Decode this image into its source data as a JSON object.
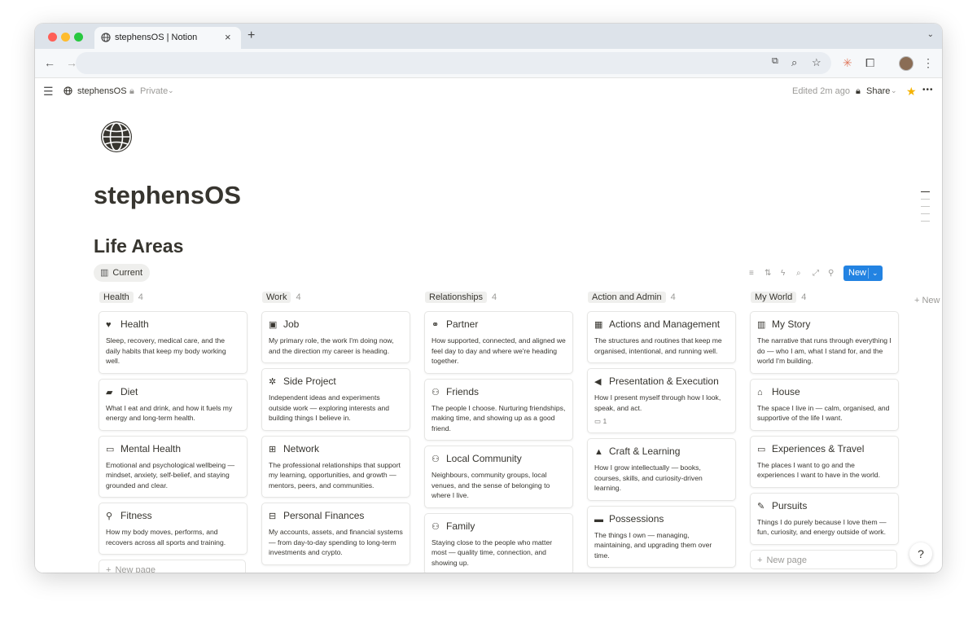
{
  "browser": {
    "tab_title": "stephensOS | Notion",
    "tab_close": "×",
    "new_tab": "+",
    "tab_menu": "⌄",
    "nav_back": "←",
    "nav_forward": "→",
    "omnibox_icons": [
      "⧉",
      "⌕",
      "☆"
    ],
    "toolbar_icons": [
      "✳",
      "⧠",
      "⋮"
    ]
  },
  "notion": {
    "breadcrumb": "stephensOS",
    "privacy": "Private",
    "edited": "Edited 2m ago",
    "share": "Share",
    "more": "•••",
    "favorite": "★",
    "menu": "☰",
    "page_title": "stephensOS",
    "section_title": "Life Areas",
    "view_tab": "Current",
    "new_button": "New",
    "new_button_caret": "⌄",
    "add_group": "+ New",
    "new_page": "New page",
    "plus": "+",
    "help": "?"
  },
  "view_tools": [
    "≡",
    "⇅",
    "ϟ",
    "⌕",
    "⤢",
    "⚲"
  ],
  "columns": [
    {
      "name": "Health",
      "count": "4",
      "cards": [
        {
          "icon": "♥",
          "title": "Health",
          "desc": "Sleep, recovery, medical care, and the daily habits that keep my body working well."
        },
        {
          "icon": "▰",
          "title": "Diet",
          "desc": "What I eat and drink, and how it fuels my energy and long-term health."
        },
        {
          "icon": "▭",
          "title": "Mental Health",
          "desc": "Emotional and psychological wellbeing — mindset, anxiety, self-belief, and staying grounded and clear."
        },
        {
          "icon": "⚲",
          "title": "Fitness",
          "desc": "How my body moves, performs, and recovers across all sports and training."
        }
      ],
      "show_new_page": true
    },
    {
      "name": "Work",
      "count": "4",
      "cards": [
        {
          "icon": "▣",
          "title": "Job",
          "desc": "My primary role, the work I'm doing now, and the direction my career is heading."
        },
        {
          "icon": "✲",
          "title": "Side Project",
          "desc": "Independent ideas and experiments outside work — exploring interests and building things I believe in."
        },
        {
          "icon": "⊞",
          "title": "Network",
          "desc": "The professional relationships that support my learning, opportunities, and growth — mentors, peers, and communities."
        },
        {
          "icon": "⊟",
          "title": "Personal Finances",
          "desc": "My accounts, assets, and financial systems — from day-to-day spending to long-term investments and crypto."
        }
      ],
      "show_new_page": false
    },
    {
      "name": "Relationships",
      "count": "4",
      "cards": [
        {
          "icon": "⚭",
          "title": "Partner",
          "desc": "How supported, connected, and aligned we feel day to day and where we're heading together."
        },
        {
          "icon": "⚇",
          "title": "Friends",
          "desc": "The people I choose. Nurturing friendships, making time, and showing up as a good friend."
        },
        {
          "icon": "⚇",
          "title": "Local Community",
          "desc": "Neighbours, community groups, local venues, and the sense of belonging to where I live."
        },
        {
          "icon": "⚇",
          "title": "Family",
          "desc": "Staying close to the people who matter most — quality time, connection, and showing up."
        }
      ],
      "show_new_page": false
    },
    {
      "name": "Action and Admin",
      "count": "4",
      "cards": [
        {
          "icon": "▦",
          "title": "Actions and Management",
          "desc": "The structures and routines that keep me organised, intentional, and running well."
        },
        {
          "icon": "◀",
          "title": "Presentation & Execution",
          "desc": "How I present myself through how I look, speak, and act.",
          "comments": "▭ 1"
        },
        {
          "icon": "▲",
          "title": "Craft & Learning",
          "desc": "How I grow intellectually — books, courses, skills, and curiosity-driven learning."
        },
        {
          "icon": "▬",
          "title": "Possessions",
          "desc": "The things I own — managing, maintaining, and upgrading them over time."
        }
      ],
      "show_new_page": false
    },
    {
      "name": "My World",
      "count": "4",
      "cards": [
        {
          "icon": "▥",
          "title": "My Story",
          "desc": "The narrative that runs through everything I do — who I am, what I stand for, and the world I'm building."
        },
        {
          "icon": "⌂",
          "title": "House",
          "desc": "The space I live in — calm, organised, and supportive of the life I want."
        },
        {
          "icon": "▭",
          "title": "Experiences & Travel",
          "desc": "The places I want to go and the experiences I want to have in the world."
        },
        {
          "icon": "✎",
          "title": "Pursuits",
          "desc": "Things I do purely because I love them — fun, curiosity, and energy outside of work."
        }
      ],
      "show_new_page": true
    }
  ],
  "colors": {
    "accent": "#2383e2",
    "close_dot": "#ff5f57",
    "min_dot": "#febc2e",
    "max_dot": "#28c840",
    "favorite": "#f5b301"
  }
}
